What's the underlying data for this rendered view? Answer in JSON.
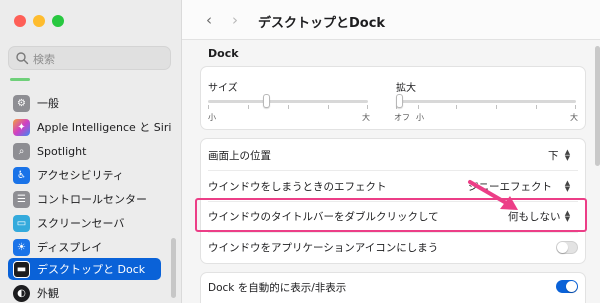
{
  "window": {
    "title": "デスクトップとDock"
  },
  "colors": {
    "accent": "#0a62d8",
    "highlight": "#ec3e87",
    "arrow": "#ec3e87"
  },
  "search": {
    "placeholder": "検索"
  },
  "sidebar": {
    "items": [
      {
        "label": "一般",
        "icon": "gear-icon",
        "color": "#8e8e93"
      },
      {
        "label": "Apple Intelligence と Siri",
        "icon": "siri-icon",
        "color": "#c43dd8"
      },
      {
        "label": "Spotlight",
        "icon": "spotlight-icon",
        "color": "#8e8e93"
      },
      {
        "label": "アクセシビリティ",
        "icon": "accessibility-icon",
        "color": "#1a73e8"
      },
      {
        "label": "コントロールセンター",
        "icon": "control-center-icon",
        "color": "#8e8e93"
      },
      {
        "label": "スクリーンセーバ",
        "icon": "screensaver-icon",
        "color": "#34aadc"
      },
      {
        "label": "ディスプレイ",
        "icon": "display-icon",
        "color": "#1a73e8"
      },
      {
        "label": "デスクトップと Dock",
        "icon": "dock-icon",
        "color": "#1d1d1f",
        "active": true
      },
      {
        "label": "外観",
        "icon": "appearance-icon",
        "color": "#1d1d1f"
      }
    ]
  },
  "dock": {
    "section_title": "Dock",
    "size": {
      "label": "サイズ",
      "min_label": "小",
      "max_label": "大",
      "value": 0.36
    },
    "magnify": {
      "label": "拡大",
      "off_label": "オフ",
      "min_label": "小",
      "max_label": "大",
      "value": 0.0
    }
  },
  "settings": {
    "position": {
      "label": "画面上の位置",
      "value": "下"
    },
    "minimize_effect": {
      "label": "ウインドウをしまうときのエフェクト",
      "value": "ジニーエフェクト"
    },
    "double_click": {
      "label": "ウインドウのタイトルバーをダブルクリックして",
      "value": "何もしない"
    },
    "minimize_to_icon": {
      "label": "ウインドウをアプリケーションアイコンにしまう",
      "value": false
    },
    "auto_hide": {
      "label": "Dock を自動的に表示/非表示",
      "value": true
    }
  }
}
